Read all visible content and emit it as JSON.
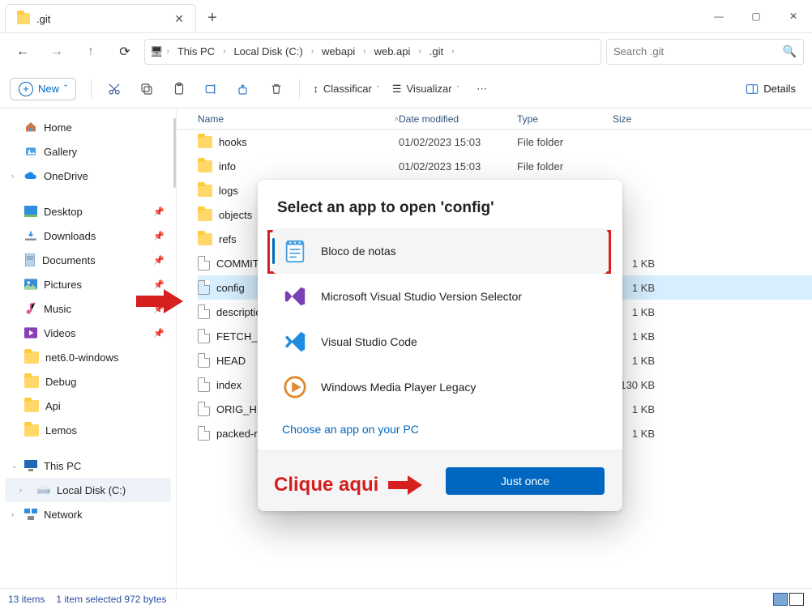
{
  "tab": {
    "title": ".git"
  },
  "breadcrumbs": [
    "This PC",
    "Local Disk (C:)",
    "webapi",
    "web.api",
    ".git"
  ],
  "search": {
    "placeholder": "Search .git"
  },
  "toolbar": {
    "new": "New",
    "sort": "Classificar",
    "view": "Visualizar",
    "details": "Details"
  },
  "nav": {
    "home": "Home",
    "gallery": "Gallery",
    "onedrive": "OneDrive",
    "quick": [
      "Desktop",
      "Downloads",
      "Documents",
      "Pictures",
      "Music",
      "Videos"
    ],
    "folders": [
      "net6.0-windows",
      "Debug",
      "Api",
      "Lemos"
    ],
    "thispc": "This PC",
    "localdisk": "Local Disk (C:)",
    "network": "Network"
  },
  "columns": {
    "name": "Name",
    "date": "Date modified",
    "type": "Type",
    "size": "Size"
  },
  "files": [
    {
      "name": "hooks",
      "date": "01/02/2023 15:03",
      "type": "File folder",
      "size": "",
      "icon": "folder"
    },
    {
      "name": "info",
      "date": "01/02/2023 15:03",
      "type": "File folder",
      "size": "",
      "icon": "folder"
    },
    {
      "name": "logs",
      "date": "",
      "type": "",
      "size": "",
      "icon": "folder"
    },
    {
      "name": "objects",
      "date": "",
      "type": "",
      "size": "",
      "icon": "folder"
    },
    {
      "name": "refs",
      "date": "",
      "type": "",
      "size": "",
      "icon": "folder"
    },
    {
      "name": "COMMIT_",
      "date": "",
      "type": "",
      "size": "1 KB",
      "icon": "file"
    },
    {
      "name": "config",
      "date": "",
      "type": "",
      "size": "1 KB",
      "icon": "file",
      "selected": true
    },
    {
      "name": "description",
      "date": "",
      "type": "",
      "size": "1 KB",
      "icon": "file"
    },
    {
      "name": "FETCH_HEA",
      "date": "",
      "type": "",
      "size": "1 KB",
      "icon": "file"
    },
    {
      "name": "HEAD",
      "date": "",
      "type": "",
      "size": "1 KB",
      "icon": "file"
    },
    {
      "name": "index",
      "date": "",
      "type": "",
      "size": "130 KB",
      "icon": "file"
    },
    {
      "name": "ORIG_HEA",
      "date": "",
      "type": "",
      "size": "1 KB",
      "icon": "file"
    },
    {
      "name": "packed-re",
      "date": "",
      "type": "",
      "size": "1 KB",
      "icon": "file"
    }
  ],
  "status": {
    "count": "13 items",
    "selection": "1 item selected  972 bytes"
  },
  "dialog": {
    "title": "Select an app to open 'config'",
    "apps": [
      "Bloco de notas",
      "Microsoft Visual Studio Version Selector",
      "Visual Studio Code",
      "Windows Media Player Legacy"
    ],
    "choose": "Choose an app on your PC",
    "justonce": "Just once"
  },
  "annotation": {
    "clique": "Clique aqui"
  }
}
